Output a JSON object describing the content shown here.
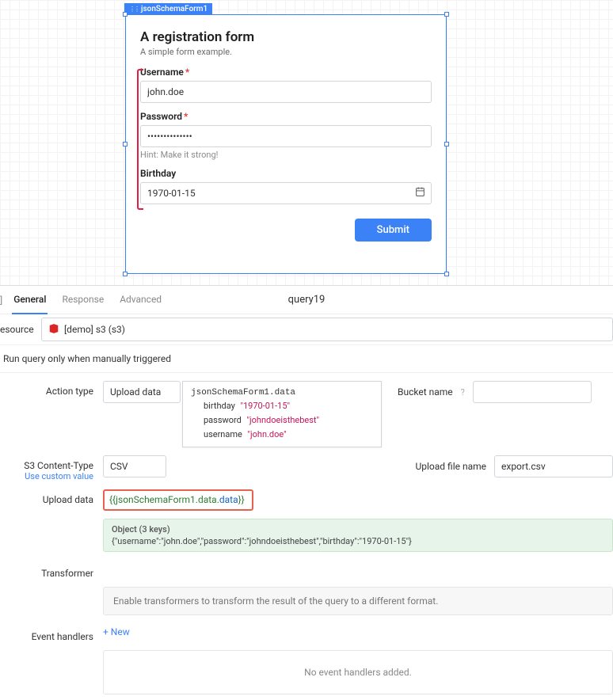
{
  "component": {
    "tag": "jsonSchemaForm1"
  },
  "form": {
    "title": "A registration form",
    "description": "A simple form example.",
    "username": {
      "label": "Username",
      "value": "john.doe"
    },
    "password": {
      "label": "Password",
      "value": "••••••••••••••",
      "hint": "Hint: Make it strong!"
    },
    "birthday": {
      "label": "Birthday",
      "value": "1970-01-15"
    },
    "submit": "Submit"
  },
  "panel": {
    "tabs": [
      "General",
      "Response",
      "Advanced"
    ],
    "query_name": "query19",
    "resource_label": "esource",
    "resource_value": "[demo] s3 (s3)",
    "trigger_text": "Run query only when manually triggered",
    "action_type": {
      "label": "Action type",
      "value": "Upload data"
    },
    "bucket_name": {
      "label": "Bucket name"
    },
    "content_type": {
      "label": "S3 Content-Type",
      "link": "Use custom value",
      "value": "CSV"
    },
    "upload_file": {
      "label": "Upload file name",
      "value": "export.csv"
    },
    "autocomplete": {
      "head": "jsonSchemaForm1.data",
      "items": [
        {
          "key": "birthday",
          "val": "\"1970-01-15\""
        },
        {
          "key": "password",
          "val": "\"johndoeisthebest\""
        },
        {
          "key": "username",
          "val": "\"john.doe\""
        }
      ]
    },
    "upload_data": {
      "label": "Upload data",
      "prefix": "{{",
      "inner": "jsonSchemaForm1.data",
      "suffix": "}}"
    },
    "object_preview": {
      "head": "Object (3 keys)",
      "body": "{\"username\":\"john.doe\",\"password\":\"johndoeisthebest\",\"birthday\":\"1970-01-15\"}"
    },
    "transformer": {
      "label": "Transformer",
      "text": "Enable transformers to transform the result of the query to a different format."
    },
    "handlers": {
      "label": "Event handlers",
      "add": "+ New",
      "empty": "No event handlers added."
    }
  }
}
